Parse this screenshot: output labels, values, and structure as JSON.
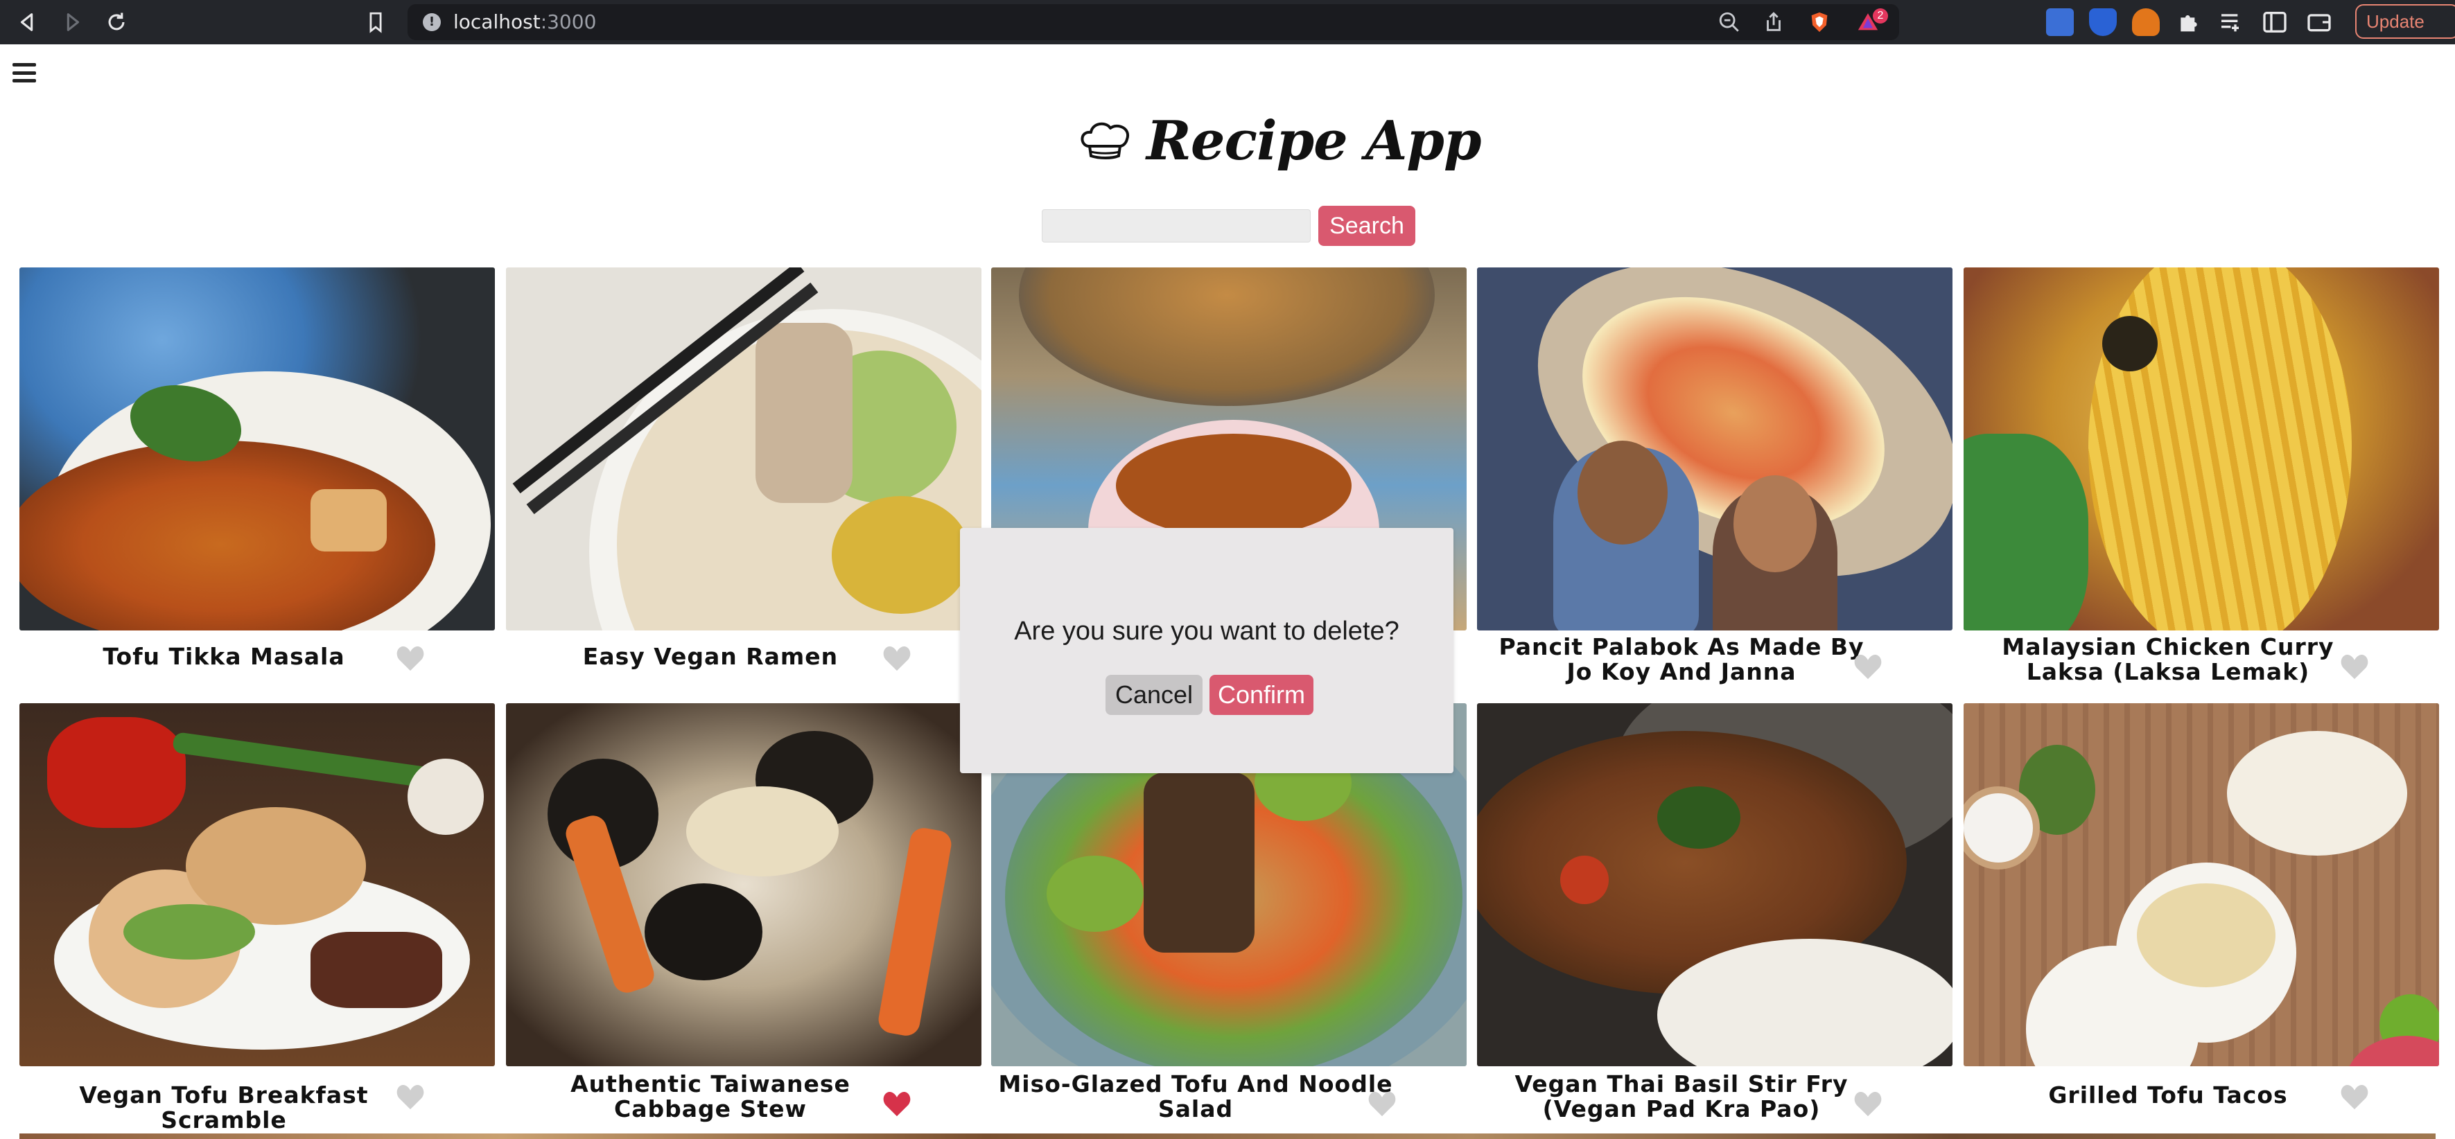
{
  "browser": {
    "url_host": "localhost",
    "url_port": ":3000",
    "update_label": "Update",
    "notification_count": "2"
  },
  "app": {
    "title": "Recipe App",
    "search_button": "Search",
    "search_placeholder": ""
  },
  "recipes": [
    {
      "title": "Tofu Tikka Masala",
      "favorited": false
    },
    {
      "title": "Easy Vegan Ramen",
      "favorited": false
    },
    {
      "title": "",
      "favorited": false
    },
    {
      "title": "Pancit Palabok As Made By Jo Koy And Janna",
      "favorited": false
    },
    {
      "title": "Malaysian Chicken Curry Laksa (Laksa Lemak)",
      "favorited": false
    },
    {
      "title": "Vegan Tofu Breakfast Scramble",
      "favorited": false
    },
    {
      "title": "Authentic Taiwanese Cabbage Stew",
      "favorited": true
    },
    {
      "title": "Miso-Glazed Tofu And Noodle Salad",
      "favorited": false
    },
    {
      "title": "Vegan Thai Basil Stir Fry (Vegan Pad Kra Pao)",
      "favorited": false
    },
    {
      "title": "Grilled Tofu Tacos",
      "favorited": false
    }
  ],
  "modal": {
    "message": "Are you sure you want to delete?",
    "cancel_label": "Cancel",
    "confirm_label": "Confirm"
  },
  "colors": {
    "accent": "#d9596f",
    "heart_inactive": "#cfcfcf",
    "heart_active": "#d6324a"
  }
}
